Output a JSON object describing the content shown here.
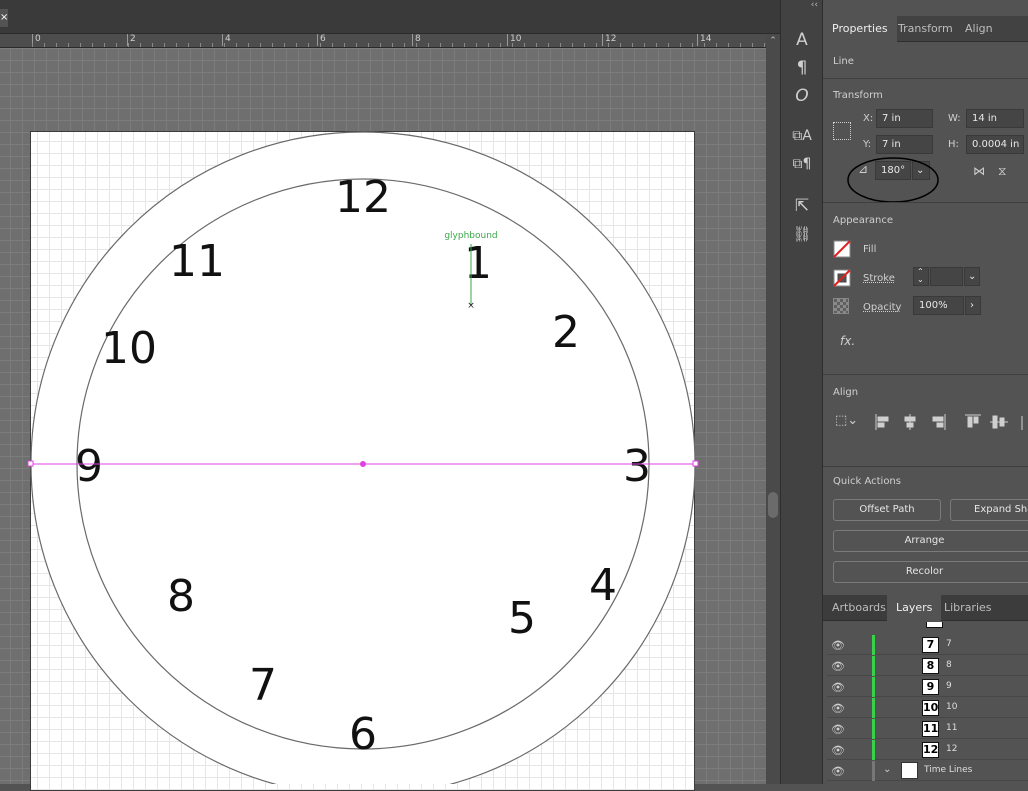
{
  "ruler": {
    "ticks": [
      "0",
      "2",
      "4",
      "6",
      "8",
      "10",
      "12",
      "14"
    ]
  },
  "doc_tab": {
    "close": "×"
  },
  "scroll": {
    "up": "⌃"
  },
  "clock": {
    "numbers": [
      "12",
      "1",
      "2",
      "3",
      "4",
      "5",
      "6",
      "7",
      "8",
      "9",
      "10",
      "11"
    ],
    "glyph_label": "glyphbound"
  },
  "toolstrip": {
    "collapse": "‹‹"
  },
  "panel": {
    "tabs": [
      "Properties",
      "Transform",
      "Align"
    ],
    "object_type": "Line",
    "transform": {
      "title": "Transform",
      "x_label": "X:",
      "x_value": "7 in",
      "y_label": "Y:",
      "y_value": "7 in",
      "w_label": "W:",
      "w_value": "14 in",
      "h_label": "H:",
      "h_value": "0.0004 in",
      "angle_value": "180°"
    },
    "appearance": {
      "title": "Appearance",
      "fill_label": "Fill",
      "stroke_label": "Stroke",
      "opacity_label": "Opacity",
      "opacity_value": "100%",
      "fx_label": "fx."
    },
    "align": {
      "title": "Align"
    },
    "quick_actions": {
      "title": "Quick Actions",
      "offset_path": "Offset Path",
      "expand_shape": "Expand Shape",
      "arrange": "Arrange",
      "recolor": "Recolor"
    },
    "bottom_tabs": [
      "Artboards",
      "Layers",
      "Libraries"
    ],
    "layers": [
      {
        "thumb": "7",
        "name": "7"
      },
      {
        "thumb": "8",
        "name": "8"
      },
      {
        "thumb": "9",
        "name": "9"
      },
      {
        "thumb": "10",
        "name": "10"
      },
      {
        "thumb": "11",
        "name": "11"
      },
      {
        "thumb": "12",
        "name": "12"
      }
    ],
    "group_layer": "Time Lines"
  },
  "colors": {
    "accent_selection": "#e040e0",
    "glyph_green": "#3aa84a",
    "layer_green": "#3ad14a"
  }
}
